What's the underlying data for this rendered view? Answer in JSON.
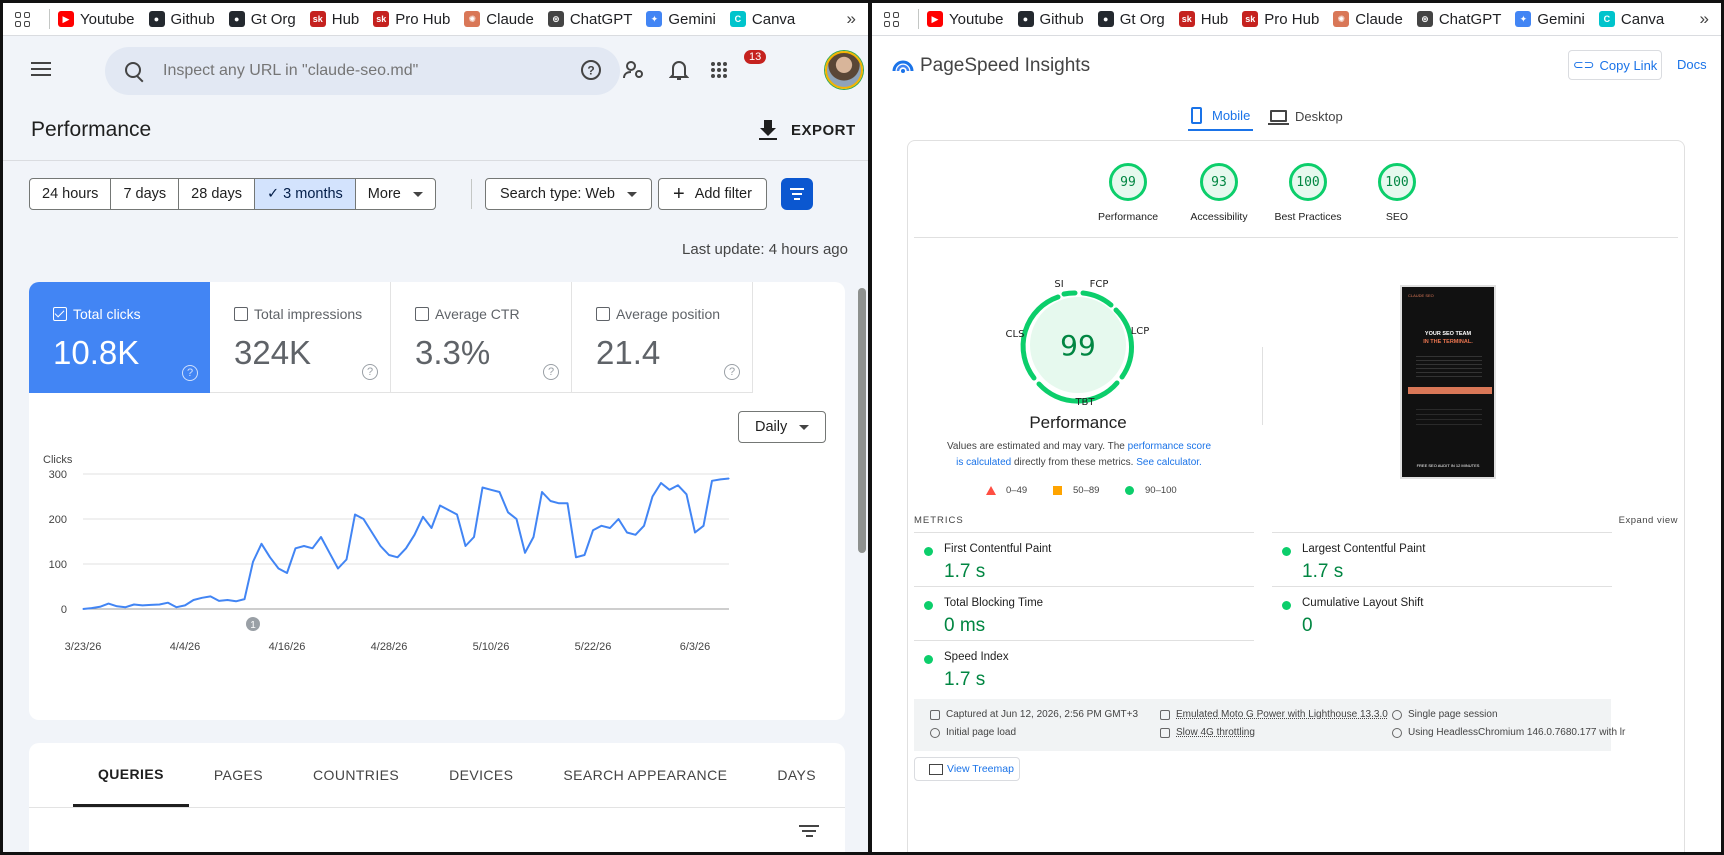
{
  "bookmarks": [
    {
      "label": "Youtube",
      "icon": "youtube-icon",
      "color": "#ff0000",
      "glyph": "▶"
    },
    {
      "label": "Github",
      "icon": "github-icon",
      "color": "#24292f",
      "glyph": "●"
    },
    {
      "label": "Gt Org",
      "icon": "github-icon",
      "color": "#24292f",
      "glyph": "●"
    },
    {
      "label": "Hub",
      "icon": "hub-icon",
      "color": "#c5221f",
      "glyph": "sk"
    },
    {
      "label": "Pro Hub",
      "icon": "hub-icon",
      "color": "#c5221f",
      "glyph": "sk"
    },
    {
      "label": "Claude",
      "icon": "claude-icon",
      "color": "#d97757",
      "glyph": "✺"
    },
    {
      "label": "ChatGPT",
      "icon": "chatgpt-icon",
      "color": "#444444",
      "glyph": "⊛"
    },
    {
      "label": "Gemini",
      "icon": "gemini-icon",
      "color": "#4285f4",
      "glyph": "✦"
    },
    {
      "label": "Canva",
      "icon": "canva-icon",
      "color": "#00c4cc",
      "glyph": "C"
    }
  ],
  "bookmarks_more": "»",
  "gsc": {
    "search_placeholder": "Inspect any URL in \"claude-seo.md\"",
    "notification_count": "13",
    "page_title": "Performance",
    "export_label": "EXPORT",
    "date_chips": [
      "24 hours",
      "7 days",
      "28 days",
      "✓  3 months"
    ],
    "more_label": "More",
    "search_type": "Search type: Web",
    "add_filter": "Add filter",
    "last_update": "Last update: 4 hours ago",
    "metrics": [
      {
        "label": "Total clicks",
        "value": "10.8K",
        "active": true
      },
      {
        "label": "Total impressions",
        "value": "324K",
        "active": false
      },
      {
        "label": "Average CTR",
        "value": "3.3%",
        "active": false
      },
      {
        "label": "Average position",
        "value": "21.4",
        "active": false
      }
    ],
    "granularity": "Daily",
    "tabs": [
      "QUERIES",
      "PAGES",
      "COUNTRIES",
      "DEVICES",
      "SEARCH APPEARANCE",
      "DAYS"
    ],
    "annotation_marker": "1",
    "accent": "#4285f4"
  },
  "chart_data": {
    "type": "line",
    "ylabel": "Clicks",
    "ylim": [
      0,
      300
    ],
    "yticks": [
      0,
      100,
      200,
      300
    ],
    "xtick_labels": [
      "3/23/26",
      "4/4/26",
      "4/16/26",
      "4/28/26",
      "5/10/26",
      "5/22/26",
      "6/3/26"
    ],
    "xtick_index": [
      0,
      12,
      24,
      36,
      48,
      60,
      72
    ],
    "series": [
      {
        "values": [
          0,
          2,
          5,
          12,
          6,
          4,
          10,
          8,
          9,
          10,
          14,
          4,
          8,
          20,
          25,
          28,
          18,
          20,
          17,
          22,
          105,
          145,
          115,
          90,
          80,
          135,
          140,
          135,
          160,
          125,
          90,
          110,
          210,
          200,
          170,
          140,
          120,
          115,
          135,
          165,
          205,
          180,
          230,
          220,
          210,
          140,
          160,
          270,
          265,
          260,
          215,
          200,
          125,
          160,
          260,
          240,
          235,
          235,
          115,
          120,
          175,
          185,
          180,
          200,
          170,
          165,
          185,
          250,
          280,
          265,
          275,
          255,
          170,
          185,
          285,
          288,
          290
        ]
      }
    ],
    "color": "#4285f4"
  },
  "psi": {
    "title": "PageSpeed Insights",
    "copy_link": "Copy Link",
    "docs": "Docs",
    "device_tabs": [
      "Mobile",
      "Desktop"
    ],
    "scores": [
      {
        "name": "Performance",
        "value": "99"
      },
      {
        "name": "Accessibility",
        "value": "93"
      },
      {
        "name": "Best Practices",
        "value": "100"
      },
      {
        "name": "SEO",
        "value": "100"
      }
    ],
    "big_score": "99",
    "big_label": "Performance",
    "gauge_labels": {
      "si": "SI",
      "fcp": "FCP",
      "lcp": "LCP",
      "tbt": "TBT",
      "cls": "CLS"
    },
    "note_pre": "Values are estimated and may vary. The ",
    "note_link1": "performance score is calculated",
    "note_mid": " directly from these metrics. ",
    "note_link2": "See calculator.",
    "legend": [
      "0–49",
      "50–89",
      "90–100"
    ],
    "metrics_header": "METRICS",
    "expand": "Expand view",
    "metrics": [
      {
        "name": "First Contentful Paint",
        "value": "1.7 s"
      },
      {
        "name": "Largest Contentful Paint",
        "value": "1.7 s"
      },
      {
        "name": "Total Blocking Time",
        "value": "0 ms"
      },
      {
        "name": "Cumulative Layout Shift",
        "value": "0"
      },
      {
        "name": "Speed Index",
        "value": "1.7 s"
      }
    ],
    "footer": [
      "Captured at Jun 12, 2026, 2:56 PM GMT+3",
      "Emulated Moto G Power with Lighthouse 13.3.0",
      "Single page session",
      "Initial page load",
      "Slow 4G throttling",
      "Using HeadlessChromium 146.0.7680.177 with lr"
    ],
    "treemap": "View Treemap",
    "screenshot": {
      "brand": "CLAUDE SEO",
      "headline1": "YOUR SEO TEAM",
      "headline2": "IN THE TERMINAL.",
      "cta": "FREE SEO AUDIT IN 12 MINUTES"
    },
    "colors": {
      "pass": "#0cce6b",
      "average": "#ffa400",
      "fail": "#ff4e42",
      "link": "#1a73e8"
    }
  }
}
